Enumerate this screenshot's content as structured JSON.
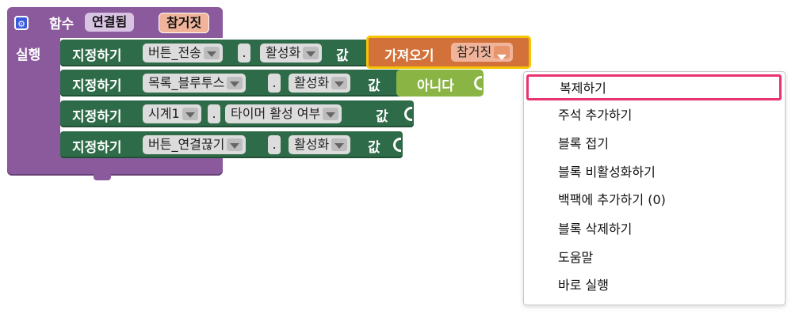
{
  "procedure": {
    "keyword": "함수",
    "name": "연결됨",
    "param": "참거짓",
    "do_label": "실행",
    "colors": {
      "proc": "#8a5a9c",
      "name_pill": "#d9c3e3",
      "param_pill": "#f0b49a"
    }
  },
  "statements": [
    {
      "set_label": "지정하기",
      "component": "버튼_전송",
      "dot": ".",
      "property": "활성화",
      "value_label": "값"
    },
    {
      "set_label": "지정하기",
      "component": "목록_블루투스",
      "dot": ".",
      "property": "활성화",
      "value_label": "값"
    },
    {
      "set_label": "지정하기",
      "component": "시계1",
      "dot": ".",
      "property": "타이머 활성 여부",
      "value_label": "값"
    },
    {
      "set_label": "지정하기",
      "component": "버튼_연결끊기",
      "dot": ".",
      "property": "활성화",
      "value_label": "값"
    }
  ],
  "getter": {
    "label": "가져오기",
    "var": "참거짓",
    "color": "#d2713a",
    "highlight": "#f5c400"
  },
  "bool_block": {
    "label": "아니다",
    "color": "#8ab544"
  },
  "context_menu": {
    "highlight_color": "#e8336f",
    "items": [
      {
        "label": "복제하기"
      },
      {
        "label": "주석 추가하기"
      },
      {
        "label": "블록 접기"
      },
      {
        "label": "블록 비활성화하기"
      },
      {
        "label": "백팩에 추가하기 (0)"
      },
      {
        "label": "블록 삭제하기"
      },
      {
        "label": "도움말"
      },
      {
        "label": "바로 실행"
      }
    ]
  }
}
